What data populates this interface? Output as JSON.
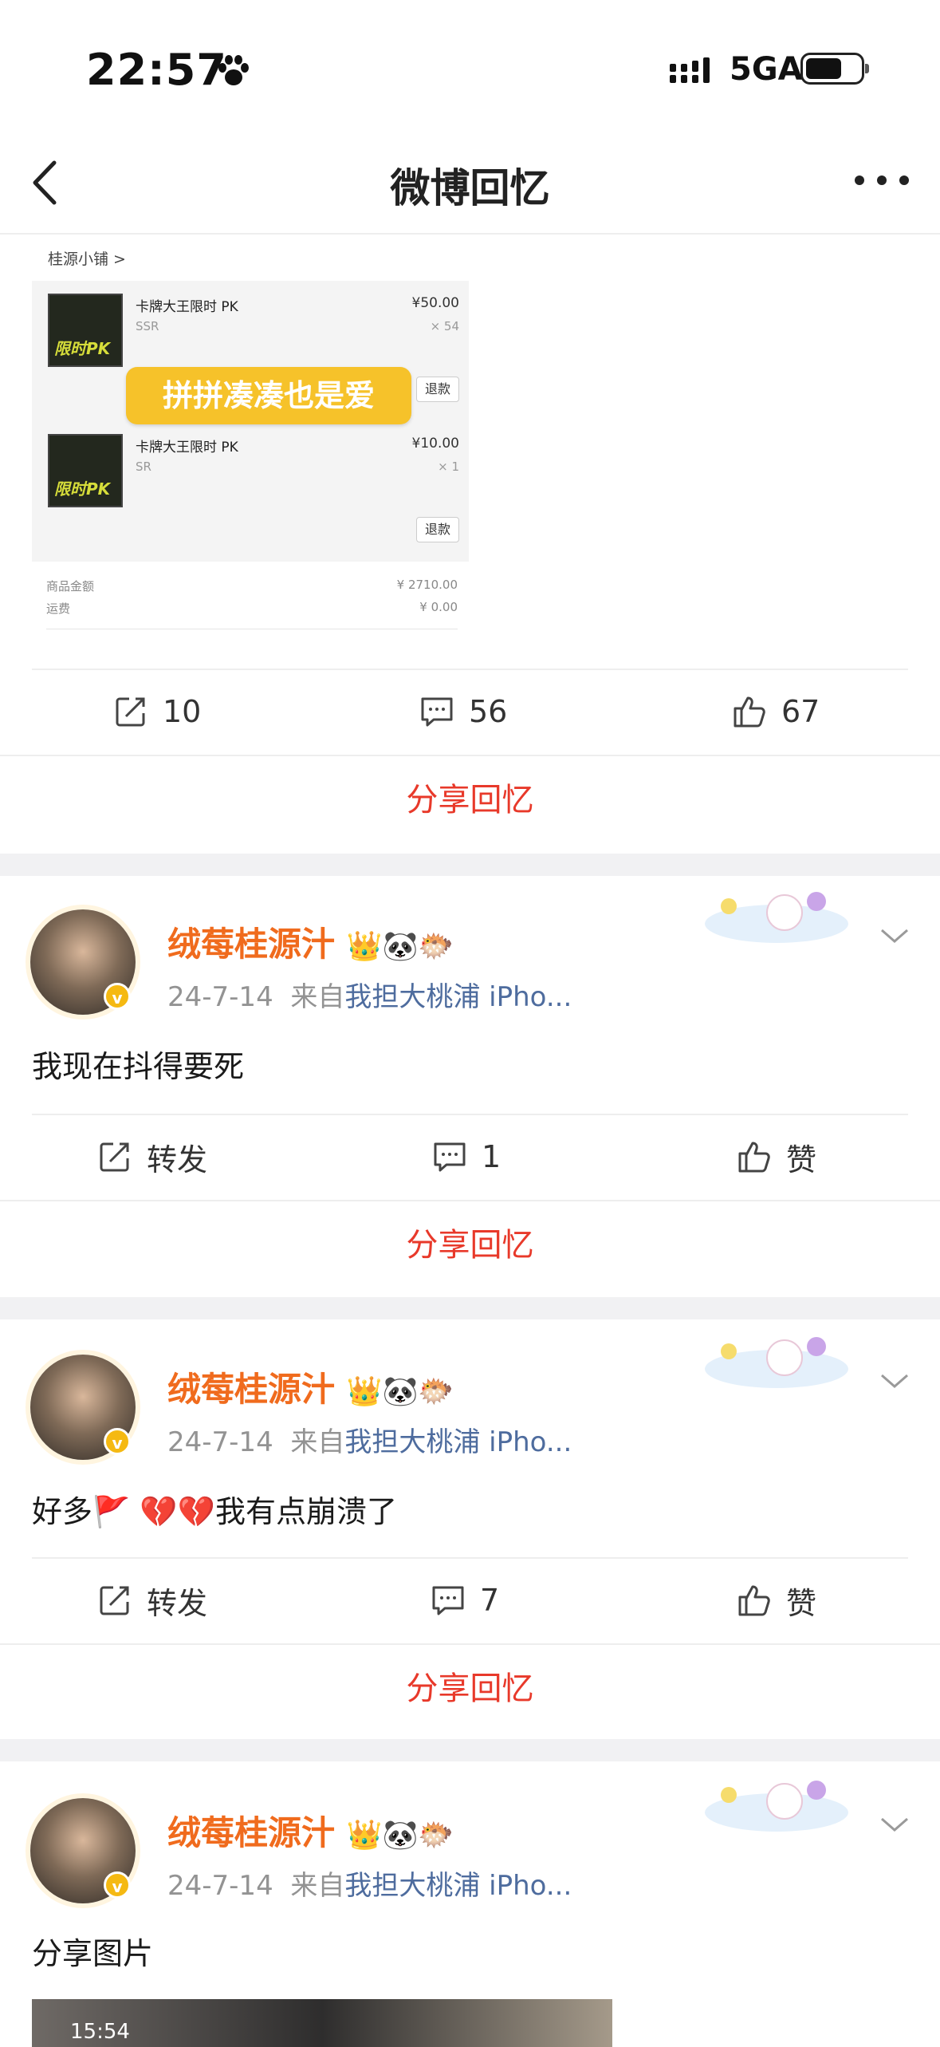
{
  "status_bar": {
    "time": "22:57",
    "network": "5GA"
  },
  "nav": {
    "title": "微博回忆"
  },
  "product": {
    "shop": "桂源小铺 >",
    "items": [
      {
        "name": "卡牌大王限时 PK",
        "grade": "SSR",
        "price": "¥50.00",
        "qty": "× 54",
        "thumb_text": "限时PK",
        "refund": "退款"
      },
      {
        "name": "卡牌大王限时 PK",
        "grade": "SR",
        "price": "¥10.00",
        "qty": "× 1",
        "thumb_text": "限时PK",
        "refund": "退款"
      }
    ],
    "sticker": "拼拼凑凑也是爱",
    "total_label": "商品金额",
    "total_value": "¥ 2710.00",
    "shipping_label": "运费",
    "shipping_value": "¥ 0.00"
  },
  "first_actions": {
    "repost": "10",
    "comments": "56",
    "likes": "67"
  },
  "share_label": "分享回忆",
  "posts": [
    {
      "username": "绒莓桂源汁",
      "badges": "👑🐼🐡",
      "date": "24-7-14",
      "from": "来自",
      "source": "我担大桃浦 iPho...",
      "text": "我现在抖得要死",
      "repost": "转发",
      "comments": "1",
      "like": "赞"
    },
    {
      "username": "绒莓桂源汁",
      "badges": "👑🐼🐡",
      "date": "24-7-14",
      "from": "来自",
      "source": "我担大桃浦 iPho...",
      "text": "好多🚩 💔💔我有点崩溃了",
      "repost": "转发",
      "comments": "7",
      "like": "赞"
    },
    {
      "username": "绒莓桂源汁",
      "badges": "👑🐼🐡",
      "date": "24-7-14",
      "from": "来自",
      "source": "我担大桃浦 iPho...",
      "text": "分享图片"
    }
  ],
  "bottom_image": {
    "time": "15:54"
  },
  "colors": {
    "accent_red": "#e8392a",
    "username_orange": "#f06b1d",
    "source_blue": "#4e6c9e"
  }
}
